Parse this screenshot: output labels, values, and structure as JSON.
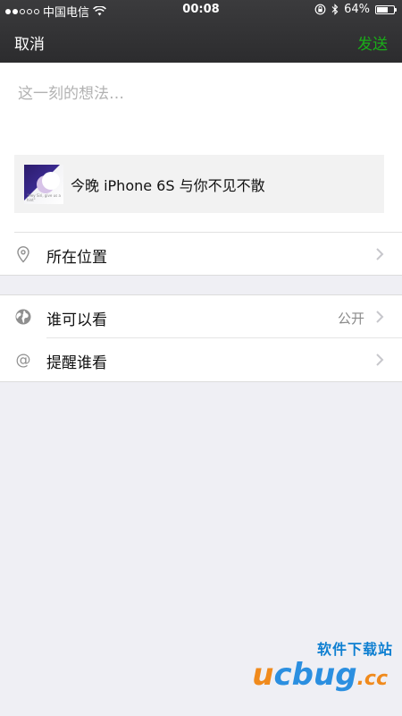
{
  "status_bar": {
    "carrier": "中国电信",
    "time": "00:08",
    "battery_percent": "64%",
    "battery_level": 0.64,
    "signal_filled": 2,
    "signal_total": 5
  },
  "nav": {
    "cancel_label": "取消",
    "send_label": "发送",
    "send_color": "#1aad19"
  },
  "compose": {
    "placeholder": "这一刻的想法…"
  },
  "link_card": {
    "title": "今晚 iPhone 6S 与你不见不散",
    "thumb_caption": "\"Hey Siri, give us a hint\""
  },
  "rows": {
    "location": {
      "label": "所在位置",
      "icon": "location-pin-icon"
    },
    "visibility": {
      "label": "谁可以看",
      "value": "公开",
      "icon": "globe-icon"
    },
    "remind": {
      "label": "提醒谁看",
      "icon": "at-icon"
    }
  },
  "watermark": {
    "site_cn": "软件下载站",
    "logo_u": "u",
    "logo_rest": "cbug",
    "logo_tld": ".cc"
  }
}
